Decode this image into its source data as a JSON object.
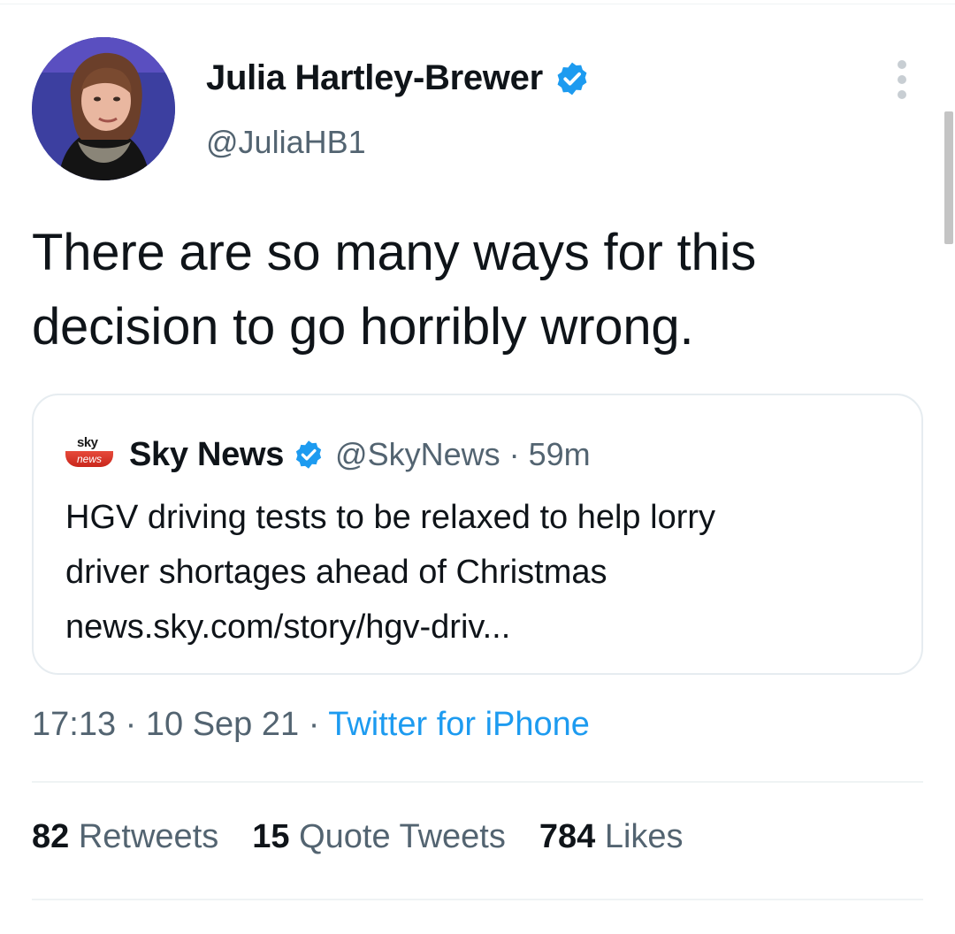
{
  "author": {
    "name": "Julia Hartley-Brewer",
    "handle": "@JuliaHB1",
    "verified_color": "#1d9bf0"
  },
  "tweet": {
    "text_line1": "There are so many ways for this",
    "text_line2": "decision to go horribly wrong.",
    "time": "17:13",
    "sep1": " · ",
    "date": "10 Sep 21",
    "sep2": " · ",
    "source": "Twitter for iPhone"
  },
  "quoted": {
    "logo_top": "sky",
    "logo_bottom": "news",
    "name": "Sky News",
    "handle": "@SkyNews",
    "sep": " · ",
    "age": "59m",
    "line1": "HGV driving tests to be relaxed to help lorry",
    "line2": "driver shortages ahead of Christmas",
    "link": "news.sky.com/story/hgv-driv..."
  },
  "stats": {
    "retweets_count": "82",
    "retweets_label": "Retweets",
    "quotes_count": "15",
    "quotes_label": "Quote Tweets",
    "likes_count": "784",
    "likes_label": "Likes"
  },
  "colors": {
    "text": "#0f1419",
    "muted": "#536471",
    "accent": "#1d9bf0",
    "border": "#e6ecf0"
  }
}
